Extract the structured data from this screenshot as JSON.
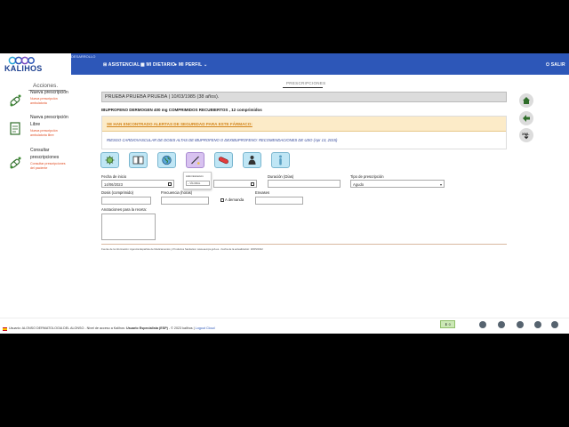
{
  "header": {
    "logo_text": "KALIHOS",
    "version": "DESARROLLO",
    "nav_asistencial": "ASISTENCIAL",
    "nav_dietario": "MI DIETARIO",
    "nav_perfil": "MI PERFIL",
    "nav_salir": "SALIR",
    "color": "#2d57b8"
  },
  "sidebar": {
    "title": "Acciones.",
    "items": [
      {
        "title": "Nueva prescripción",
        "sub": [
          "Nueva prescripción",
          "ambulatoria"
        ],
        "icon": "pills-prescription-icon"
      },
      {
        "title_lines": [
          "Nueva prescripción",
          "Libre"
        ],
        "sub": [
          "Nueva prescripción",
          "ambulatoria libre"
        ],
        "icon": "document-prescription-icon"
      },
      {
        "title_lines": [
          "Consultar",
          "prescripciones"
        ],
        "sub": [
          "Consultar prescripciones",
          "del paciente"
        ],
        "icon": "pills-search-icon"
      }
    ]
  },
  "main": {
    "tab_label": "PRESCRIPCIONES",
    "patient": "PRUEBA PRUEBA PRUEBA | 10/03/1985 (38 años).",
    "drug": "IBUPROFENO DERMOGEN 400 mg COMPRIMIDOS RECUBIERTOS , 12 comprimidos",
    "alert_title": "SE HAN ENCONTRADO ALERTAS DE SEGURIDAD PARA ESTE FÁRMACO:",
    "alert_detail": "RIESGO CARDIOVASCULAR DE DOSIS ALTAS DE IBUPROFENO O DEXIBUPROFENO: RECOMENDACIONES DE USO (Apr 13, 2015)",
    "route_popup": {
      "label": "Administración",
      "value": "-- VÍA ORAL"
    },
    "form": {
      "fecha_inicio_label": "Fecha de inicio",
      "fecha_inicio_value": "14/06/2023",
      "duracion_label": "Duración (Días)",
      "tipo_label": "Tipo de prescripción",
      "tipo_value": "Agudo",
      "dosis_label": "Dosis (comprimido)",
      "frecuencia_label": "Frecuencia (horas)",
      "demanda_label": "A demanda",
      "envases_label": "Envases",
      "anotaciones_label": "Anotaciones para la receta:"
    },
    "source_note": "Fuente de la información: Agencia Española de Medicamentos y Productos Sanitarios: www.aemps.gob.es - Fecha de la actualización: 18/05/2022"
  },
  "right_tools": {
    "xml_label": "XML"
  },
  "footer": {
    "user_label": "Usuario:",
    "user_name": "ALONSO DERMATOLOGIA DEL ALONSO",
    "access_text": "- Nivel de acceso a Kalihos:",
    "access_value": "Usuario Especialista (ESP)",
    "copyright": "- © 2023 kalihos",
    "separator": "|",
    "logout": "Logout Cloud",
    "badge": "0"
  }
}
